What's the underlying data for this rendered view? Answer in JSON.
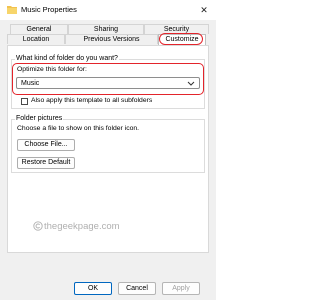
{
  "window": {
    "title": "Music Properties",
    "close_glyph": "✕"
  },
  "tabs": {
    "row1": [
      "General",
      "Sharing",
      "Security"
    ],
    "row2": [
      "Location",
      "Previous Versions",
      "Customize"
    ],
    "active": "Customize"
  },
  "folder_type": {
    "group_label": "What kind of folder do you want?",
    "optimize_label": "Optimize this folder for:",
    "selected_value": "Music",
    "apply_subfolders_label": "Also apply this template to all subfolders",
    "apply_subfolders_checked": false
  },
  "folder_pictures": {
    "group_label": "Folder pictures",
    "hint": "Choose a file to show on this folder icon.",
    "choose_file_label": "Choose File...",
    "restore_default_label": "Restore Default"
  },
  "watermark": {
    "text": "thegeekpage.com"
  },
  "buttons": {
    "ok": "OK",
    "cancel": "Cancel",
    "apply": "Apply"
  },
  "colors": {
    "highlight": "#e3242b",
    "ok_border": "#0067c0"
  }
}
